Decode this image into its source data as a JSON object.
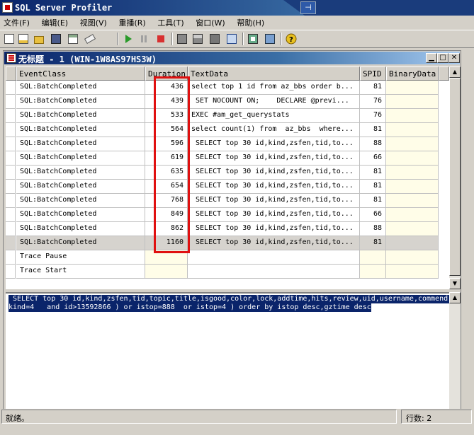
{
  "window": {
    "title": "SQL Server Profiler"
  },
  "menu": [
    "文件(F)",
    "编辑(E)",
    "视图(V)",
    "重播(R)",
    "工具(T)",
    "窗口(W)",
    "帮助(H)"
  ],
  "toolbar_icons": [
    "new-trace-icon",
    "new-template-icon",
    "open-icon",
    "save-icon",
    "properties-icon",
    "clear-icon",
    "run-icon",
    "pause-icon",
    "stop-icon",
    "find-icon",
    "replace-icon",
    "column-filter-icon",
    "auto-scroll-icon",
    "sql-server-icon",
    "activity-monitor-icon",
    "help-icon"
  ],
  "trace_window": {
    "title": "无标题 - 1 (WIN-1W8AS97HS3W)"
  },
  "grid": {
    "columns": [
      "EventClass",
      "Duration",
      "TextData",
      "SPID",
      "BinaryData"
    ],
    "rows": [
      {
        "event": "SQL:BatchCompleted",
        "duration": "436",
        "text": "select top 1 id from az_bbs order b...",
        "spid": "81"
      },
      {
        "event": "SQL:BatchCompleted",
        "duration": "439",
        "text": " SET NOCOUNT ON;    DECLARE @previ...",
        "spid": "76"
      },
      {
        "event": "SQL:BatchCompleted",
        "duration": "533",
        "text": "EXEC #am_get_querystats",
        "spid": "76"
      },
      {
        "event": "SQL:BatchCompleted",
        "duration": "564",
        "text": "select count(1) from  az_bbs  where...",
        "spid": "81"
      },
      {
        "event": "SQL:BatchCompleted",
        "duration": "596",
        "text": " SELECT top 30 id,kind,zsfen,tid,to...",
        "spid": "88"
      },
      {
        "event": "SQL:BatchCompleted",
        "duration": "619",
        "text": " SELECT top 30 id,kind,zsfen,tid,to...",
        "spid": "66"
      },
      {
        "event": "SQL:BatchCompleted",
        "duration": "635",
        "text": " SELECT top 30 id,kind,zsfen,tid,to...",
        "spid": "81"
      },
      {
        "event": "SQL:BatchCompleted",
        "duration": "654",
        "text": " SELECT top 30 id,kind,zsfen,tid,to...",
        "spid": "81"
      },
      {
        "event": "SQL:BatchCompleted",
        "duration": "768",
        "text": " SELECT top 30 id,kind,zsfen,tid,to...",
        "spid": "81"
      },
      {
        "event": "SQL:BatchCompleted",
        "duration": "849",
        "text": " SELECT top 30 id,kind,zsfen,tid,to...",
        "spid": "66"
      },
      {
        "event": "SQL:BatchCompleted",
        "duration": "862",
        "text": " SELECT top 30 id,kind,zsfen,tid,to...",
        "spid": "88"
      },
      {
        "event": "SQL:BatchCompleted",
        "duration": "1160",
        "text": " SELECT top 30 id,kind,zsfen,tid,to...",
        "spid": "81"
      },
      {
        "event": "Trace Pause",
        "duration": "",
        "text": "",
        "spid": ""
      },
      {
        "event": "Trace Start",
        "duration": "",
        "text": "",
        "spid": ""
      }
    ],
    "selected_index": 11
  },
  "detail_text": {
    "line1": " SELECT top 30 id,kind,zsfen,tid,topic,title,isgood,color,lock,addtime,hits,review,uid,username,commend,",
    "line2": "kind=4   and id>13592866 ) or istop=888  or istop=4 ) order by istop desc,gztime desc"
  },
  "status": {
    "left": "就绪。",
    "right": "行数: 2"
  },
  "colors": {
    "highlight": "#e01010",
    "titlebar": "#0a246a",
    "selection": "#0a246a"
  }
}
